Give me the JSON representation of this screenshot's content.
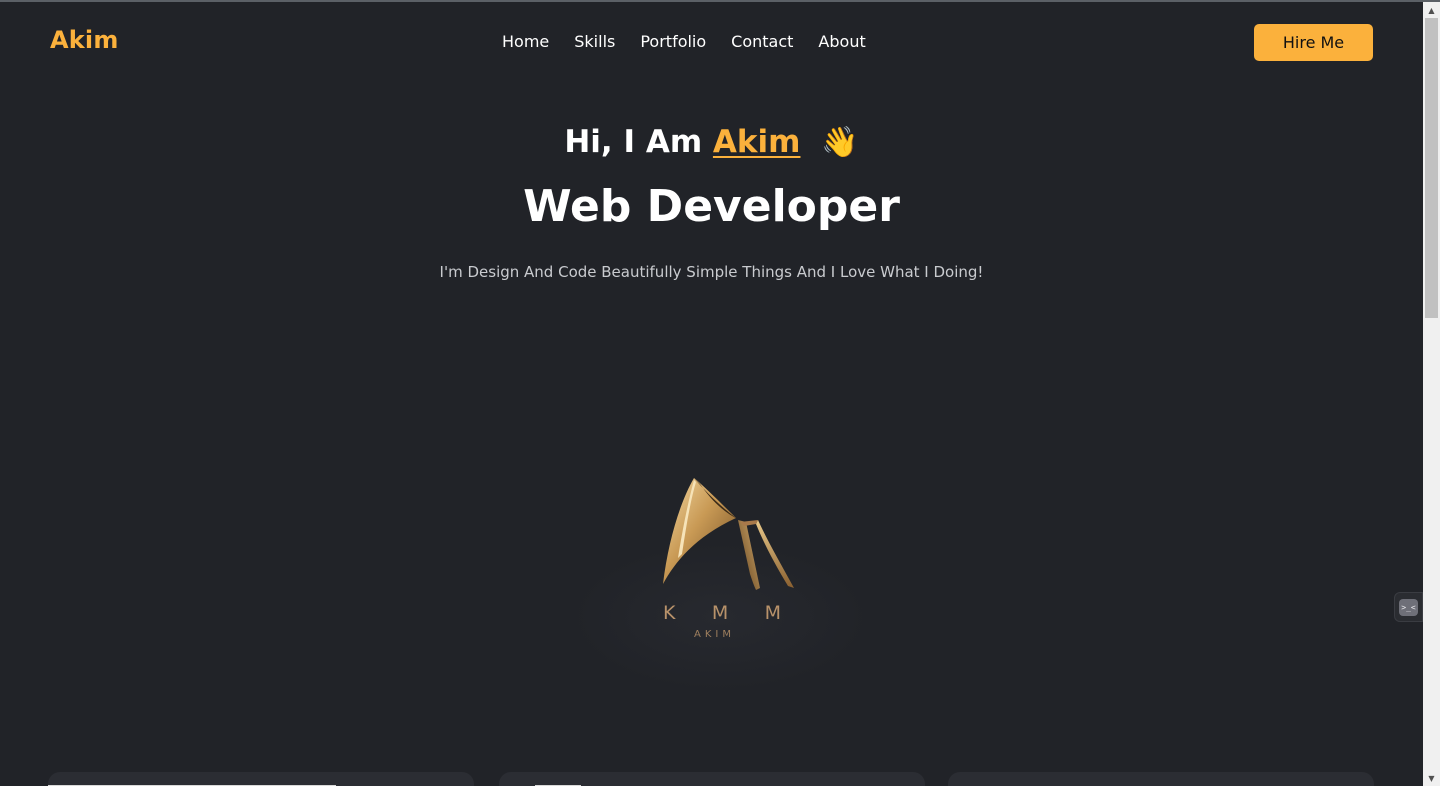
{
  "navbar": {
    "logo": "Akim",
    "links": [
      {
        "label": "Home"
      },
      {
        "label": "Skills"
      },
      {
        "label": "Portfolio"
      },
      {
        "label": "Contact"
      },
      {
        "label": "About"
      }
    ],
    "cta_label": "Hire Me"
  },
  "hero": {
    "greeting_prefix": "Hi, I Am",
    "greeting_name": "Akim",
    "wave_emoji": "👋",
    "title": "Web Developer",
    "subtitle": "I'm Design And Code Beautifully Simple Things And I Love What I Doing!"
  },
  "brand": {
    "letters": [
      "K",
      "M",
      "M"
    ],
    "name": "AKIM"
  },
  "widget": {
    "icon": "chat-bot-icon",
    "glyph": ">_<"
  },
  "colors": {
    "background": "#212328",
    "accent": "#fbb13c",
    "text": "#ffffff",
    "muted": "#c9cbcf",
    "gold": "#b8926a"
  }
}
